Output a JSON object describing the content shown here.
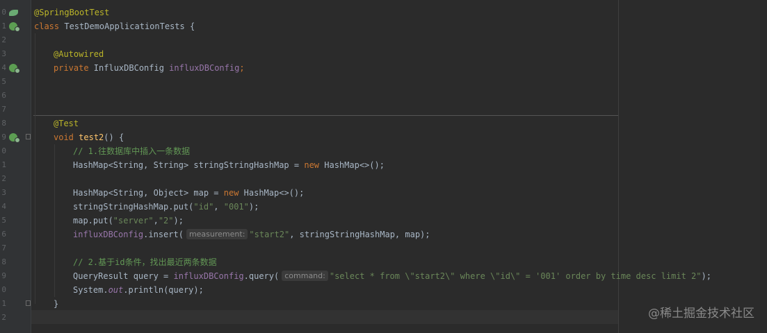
{
  "gutter": {
    "line_numbers": [
      "0",
      "1",
      "2",
      "3",
      "4",
      "5",
      "6",
      "7",
      "8",
      "9",
      "0",
      "1",
      "2",
      "3",
      "4",
      "5",
      "6",
      "7",
      "8",
      "9",
      "0",
      "1",
      "2"
    ]
  },
  "code": {
    "l0": {
      "annotation": "@SpringBootTest"
    },
    "l1": {
      "kw": "class",
      "text": " TestDemoApplicationTests {"
    },
    "l3": {
      "annotation": "@Autowired"
    },
    "l4": {
      "kw": "private",
      "type": " InfluxDBConfig ",
      "field": "influxDBConfig",
      "end": ";"
    },
    "l8": {
      "annotation": "@Test"
    },
    "l9": {
      "kw": "void",
      "sp": " ",
      "method": "test2",
      "end": "() {"
    },
    "l10": {
      "comment": "// 1.往数据库中插入一条数据"
    },
    "l11": {
      "a": "HashMap<String, String> stringStringHashMap = ",
      "kw": "new",
      "b": " HashMap<>();"
    },
    "l13": {
      "a": "HashMap<String, Object> map = ",
      "kw": "new",
      "b": " HashMap<>();"
    },
    "l14": {
      "a": "stringStringHashMap.put(",
      "s1": "\"id\"",
      "comma": ", ",
      "s2": "\"001\"",
      "end": ");"
    },
    "l15": {
      "a": "map.put(",
      "s1": "\"server\"",
      "comma": ",",
      "s2": "\"2\"",
      "end": ");"
    },
    "l16": {
      "field": "influxDBConfig",
      "a": ".insert(",
      "hint": "measurement:",
      "s1": "\"start2\"",
      "end": ", stringStringHashMap, map);"
    },
    "l18": {
      "comment": "// 2.基于id条件，找出最近两条数据"
    },
    "l19": {
      "a": "QueryResult query = ",
      "field": "influxDBConfig",
      "b": ".query(",
      "hint": "command:",
      "s1": "\"select * from \\\"start2\\\" where \\\"id\\\" = '001' order by time desc limit 2\"",
      "end": ");"
    },
    "l20": {
      "a": "System.",
      "out": "out",
      "b": ".println(query);"
    },
    "l21": {
      "text": "}"
    }
  },
  "watermark": "@稀土掘金技术社区",
  "colors": {
    "background": "#2b2b2b",
    "gutter": "#313335",
    "keyword": "#cc7832",
    "string": "#6a8759",
    "annotation": "#bbb529",
    "field": "#9876aa",
    "comment": "#629755",
    "method": "#ffc66d",
    "text": "#a9b7c6"
  },
  "icons": {
    "line0": "spring-bean-leaf-icon",
    "line1": "spring-run-icon",
    "line4": "spring-autowired-icon",
    "line9": "test-run-icon",
    "fold": "code-fold-icon"
  }
}
